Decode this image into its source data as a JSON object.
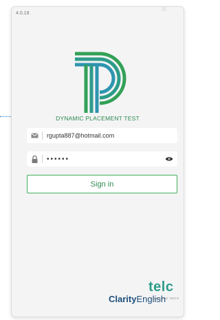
{
  "app": {
    "version": "4.0.18",
    "brand_name": "DYNAMIC PLACEMENT TEST"
  },
  "login": {
    "email_value": "rgupta887@hotmail.com",
    "password_value": "••••••",
    "sign_in_label": "Sign in"
  },
  "footer": {
    "clarity_bold": "Clarity",
    "clarity_rest": "English",
    "telc": "telc",
    "telc_tagline": "LANGUAGE TESTS"
  },
  "icons": {
    "email": "envelope-icon",
    "password": "lock-icon",
    "toggle": "eye-icon"
  },
  "colors": {
    "accent": "#3fae5a",
    "brand_text": "#2f8a4e",
    "clarity_blue": "#1d4e7a",
    "telc_teal": "#2d9c8a"
  }
}
